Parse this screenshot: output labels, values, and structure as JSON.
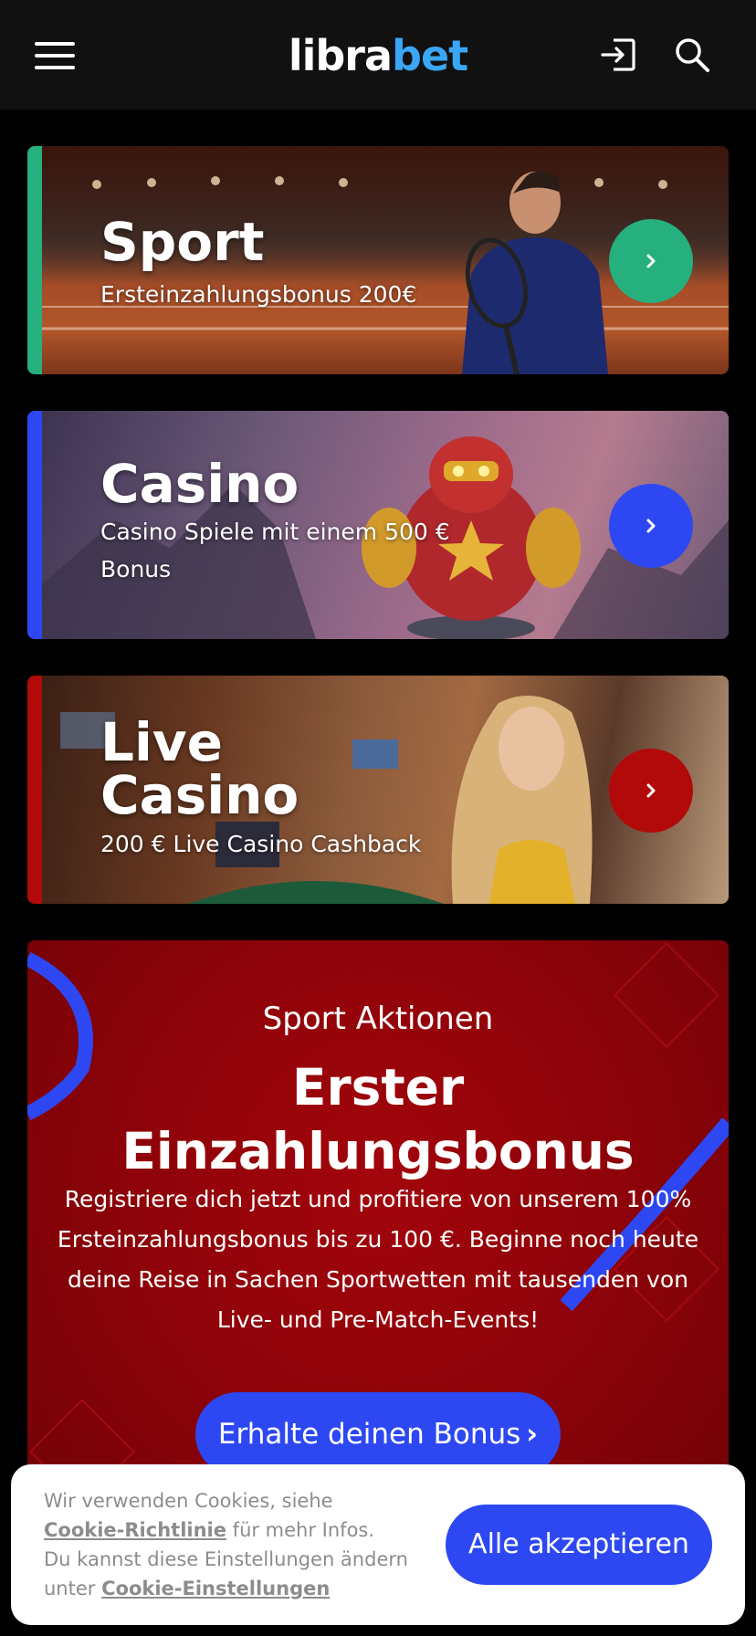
{
  "header": {
    "logo_part1": "libra",
    "logo_part2": "bet"
  },
  "cards": [
    {
      "title": "Sport",
      "subtitle": "Ersteinzahlungsbonus 200€",
      "accent": "#25b07e"
    },
    {
      "title": "Casino",
      "subtitle": "Casino Spiele mit einem 500 € Bonus",
      "accent": "#2d48f2"
    },
    {
      "title_line1": "Live",
      "title_line2": "Casino",
      "subtitle": "200 € Live Casino Cashback",
      "accent": "#b20a0a"
    }
  ],
  "promo": {
    "small_title": "Sport Aktionen",
    "big_title": "Erster Einzahlungsbonus",
    "text": "Registriere dich jetzt und profitiere von unserem 100% Ersteinzahlungsbonus bis zu 100 €. Beginne noch heute deine Reise in Sachen Sportwetten mit tausenden von Live- und Pre-Match-Events!",
    "button_label": "Erhalte deinen Bonus",
    "button_chevron": "›"
  },
  "cookie": {
    "text_part1": "Wir verwenden Cookies, siehe",
    "link1": "Cookie-Richtlinie",
    "text_part2": "für mehr Infos.",
    "text_part3": "Du kannst diese Einstellungen ändern unter",
    "link2": "Cookie-Einstellungen",
    "accept_label": "Alle akzeptieren"
  },
  "colors": {
    "primary": "#2d48f2",
    "sport": "#25b07e",
    "live": "#b20a0a",
    "logo_accent": "#3aa6f5"
  }
}
